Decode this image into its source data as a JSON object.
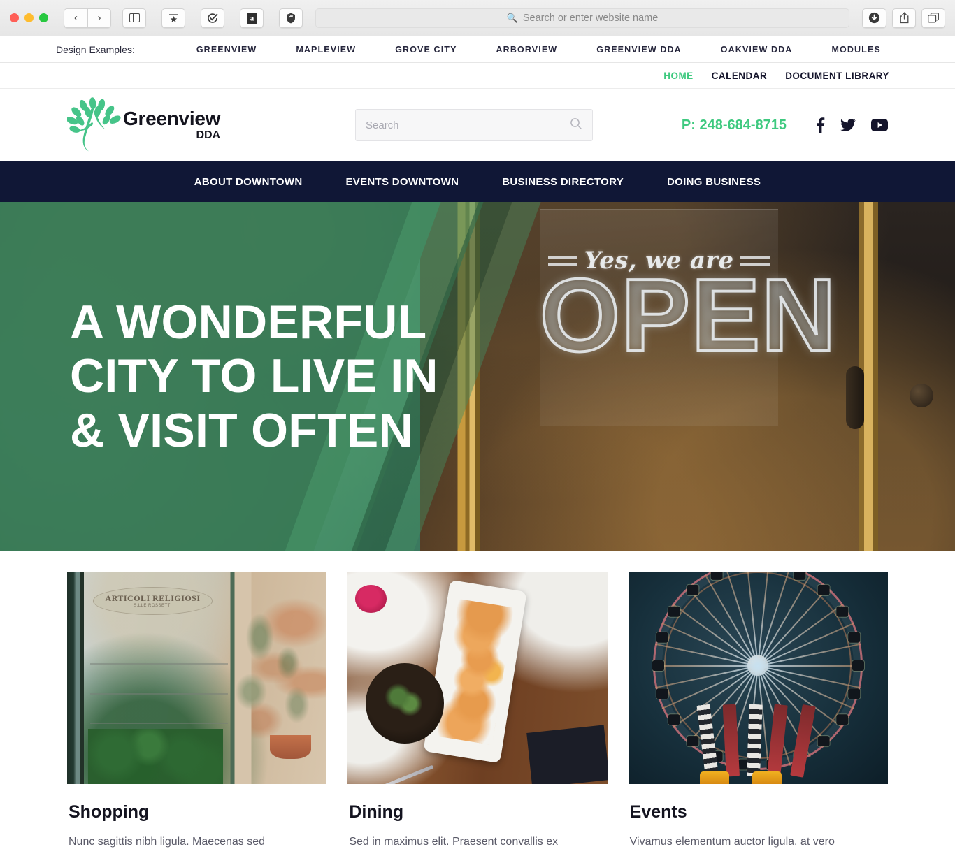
{
  "browser": {
    "traffic_lights": [
      "close",
      "minimize",
      "zoom"
    ],
    "back_icon": "chevron-left-icon",
    "forward_icon": "chevron-right-icon",
    "sidebar_icon": "sidebar-icon",
    "reader_icon": "star-bookmark-icon",
    "check_icon": "checkmark-circle-icon",
    "amazon_icon": "amazon-icon",
    "shield_icon": "shield-icon",
    "url_placeholder": "Search or enter website name",
    "search_icon": "search-icon",
    "download_icon": "download-icon",
    "share_icon": "share-icon",
    "tabs_icon": "tab-overview-icon"
  },
  "examples_bar": {
    "label": "Design Examples:",
    "links": [
      "GREENVIEW",
      "MAPLEVIEW",
      "GROVE CITY",
      "ARBORVIEW",
      "GREENVIEW DDA",
      "OAKVIEW DDA",
      "MODULES"
    ]
  },
  "utility_nav": {
    "items": [
      {
        "label": "HOME",
        "active": true
      },
      {
        "label": "CALENDAR",
        "active": false
      },
      {
        "label": "DOCUMENT LIBRARY",
        "active": false
      }
    ]
  },
  "header": {
    "logo": {
      "name": "Greenview",
      "sub": "DDA",
      "mark": "tree-logo-icon"
    },
    "search": {
      "placeholder": "Search",
      "value": "",
      "icon": "search-icon"
    },
    "phone": "P: 248-684-8715",
    "socials": [
      {
        "name": "facebook-icon"
      },
      {
        "name": "twitter-icon"
      },
      {
        "name": "youtube-icon"
      }
    ]
  },
  "main_nav": {
    "background": "#101736",
    "items": [
      "ABOUT DOWNTOWN",
      "EVENTS DOWNTOWN",
      "BUSINESS DIRECTORY",
      "DOING BUSINESS"
    ]
  },
  "hero": {
    "title_lines": [
      "A WONDERFUL",
      "CITY TO LIVE IN",
      "& VISIT OFTEN"
    ],
    "photo_sign_script": "Yes, we are",
    "photo_sign_word": "OPEN"
  },
  "cards": [
    {
      "title": "Shopping",
      "desc": "Nunc sagittis nibh ligula. Maecenas sed",
      "image_name": "storefront-window-photo",
      "image_caption": "ARTICOLI RELIGIOSI",
      "image_caption_sub": "S.LLE ROSSETTI"
    },
    {
      "title": "Dining",
      "desc": "Sed in maximus elit. Praesent convallis ex",
      "image_name": "shrimp-plate-photo"
    },
    {
      "title": "Events",
      "desc": "Vivamus elementum auctor ligula, at vero",
      "image_name": "ferris-wheel-photo"
    }
  ],
  "colors": {
    "navy": "#101736",
    "green_accent": "#3ec97f",
    "hero_green": "#387855",
    "text_dark": "#13131f",
    "text_muted": "#5a5a68"
  }
}
